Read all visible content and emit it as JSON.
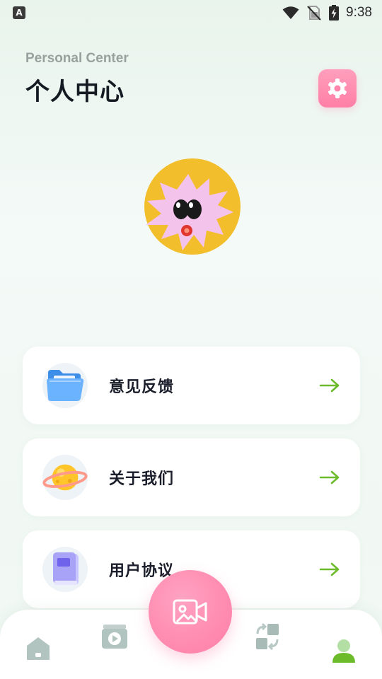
{
  "status_bar": {
    "time": "9:38",
    "notification_icon": "a-letter-icon",
    "icons": [
      "wifi-icon",
      "sim-off-icon",
      "battery-charging-icon"
    ]
  },
  "header": {
    "subtitle": "Personal Center",
    "title": "个人中心",
    "settings_icon": "settings-gear-icon"
  },
  "menu": {
    "items": [
      {
        "label": "意见反馈",
        "icon": "folder-icon"
      },
      {
        "label": "关于我们",
        "icon": "planet-icon"
      },
      {
        "label": "用户协议",
        "icon": "notebook-icon"
      }
    ],
    "arrow_icon": "arrow-right-icon"
  },
  "bottom_nav": {
    "items": [
      "home-icon",
      "video-player-icon",
      "record-camera-icon",
      "convert-icon",
      "profile-icon"
    ],
    "active": "profile-icon"
  },
  "colors": {
    "accent_pink": "#ff88ae",
    "arrow_green": "#6cbb2b",
    "avatar_yellow": "#f2be2c",
    "avatar_pink": "#f4c3ec",
    "active_green": "#6cbb2b"
  }
}
